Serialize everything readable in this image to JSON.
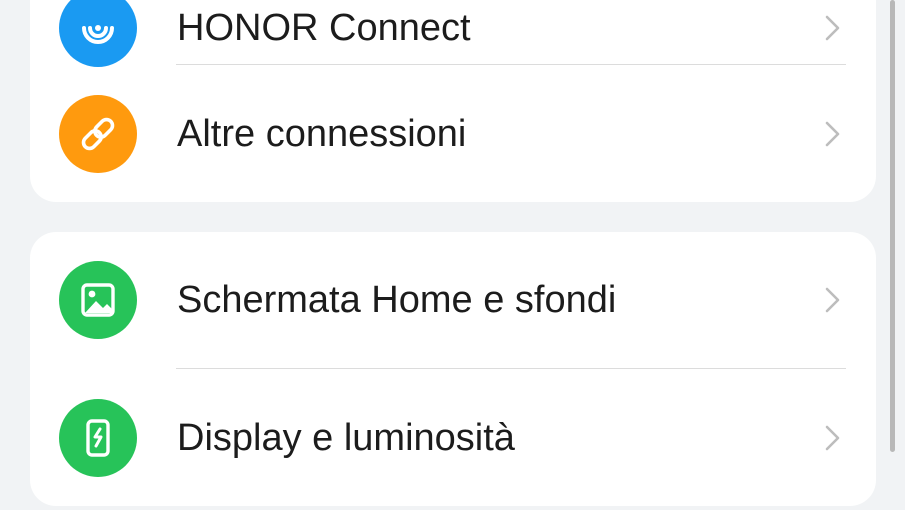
{
  "settings": {
    "group1": {
      "items": [
        {
          "label": "HONOR Connect",
          "icon": "honor-connect-icon",
          "color": "#1a9af2"
        },
        {
          "label": "Altre connessioni",
          "icon": "link-icon",
          "color": "#ff9a0e"
        }
      ]
    },
    "group2": {
      "items": [
        {
          "label": "Schermata Home e sfondi",
          "icon": "image-icon",
          "color": "#27c359"
        },
        {
          "label": "Display e luminosità",
          "icon": "phone-brightness-icon",
          "color": "#27c359"
        }
      ]
    }
  }
}
